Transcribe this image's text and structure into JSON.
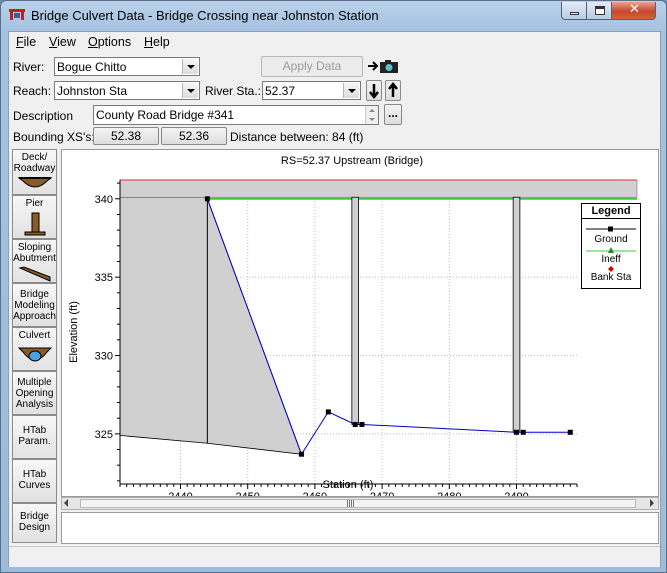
{
  "window": {
    "title": "Bridge Culvert Data - Bridge Crossing near Johnston Station",
    "minimize_icon": "minimize-icon",
    "maximize_icon": "maximize-icon",
    "close_icon": "close-icon"
  },
  "menu": [
    {
      "key": "F",
      "rest": "ile"
    },
    {
      "key": "V",
      "rest": "iew"
    },
    {
      "key": "O",
      "rest": "ptions"
    },
    {
      "key": "H",
      "rest": "elp"
    }
  ],
  "form": {
    "river_label": "River:",
    "river_value": "Bogue Chitto",
    "apply_label": "Apply Data",
    "reach_label": "Reach:",
    "reach_value": "Johnston Sta",
    "river_sta_label": "River Sta.:",
    "river_sta_value": "52.37",
    "description_label": "Description",
    "description_value": "County Road Bridge #341",
    "ellipsis": "...",
    "bounding_label": "Bounding XS's:",
    "bounding_up": "52.38",
    "bounding_down": "52.36",
    "distance_text": "Distance between: 84 (ft)"
  },
  "sidebar": [
    {
      "lines": [
        "Deck/",
        "Roadway"
      ],
      "icon": "deck-roadway-icon"
    },
    {
      "lines": [
        "Pier"
      ],
      "icon": "pier-icon"
    },
    {
      "lines": [
        "Sloping",
        "Abutment"
      ],
      "icon": "sloping-abutment-icon"
    },
    {
      "lines": [
        "Bridge",
        "Modeling",
        "Approach"
      ],
      "icon": ""
    },
    {
      "lines": [
        "Culvert"
      ],
      "icon": "culvert-icon"
    },
    {
      "lines": [
        "Multiple",
        "Opening",
        "Analysis"
      ],
      "icon": ""
    },
    {
      "lines": [
        "HTab",
        "Param."
      ],
      "icon": ""
    },
    {
      "lines": [
        "HTab",
        "Curves"
      ],
      "icon": ""
    },
    {
      "lines": [
        "Bridge",
        "Design"
      ],
      "icon": ""
    }
  ],
  "colors": {
    "ground": "#0000c8",
    "ineff": "#3cc83c",
    "bank": "#e00000",
    "deck_fill": "#d0d0d0",
    "deck_top": "#e05050"
  },
  "chart_data": {
    "type": "line",
    "title": "RS=52.37   Upstream  (Bridge)",
    "xlabel": "Station (ft)",
    "ylabel": "Elevation (ft)",
    "xlim": [
      2431,
      2499
    ],
    "ylim": [
      321.8,
      341.2
    ],
    "xticks": [
      2440,
      2450,
      2460,
      2470,
      2480,
      2490
    ],
    "yticks": [
      325,
      330,
      335,
      340
    ],
    "grid": true,
    "legend": {
      "title": "Legend",
      "placement": "top-right",
      "entries": [
        "Ground",
        "Ineff",
        "Bank Sta"
      ]
    },
    "series": [
      {
        "name": "Ground",
        "points": [
          [
            2444,
            340
          ],
          [
            2458,
            323.7
          ],
          [
            2462,
            326.4
          ],
          [
            2466,
            325.6
          ],
          [
            2467,
            325.6
          ],
          [
            2490,
            325.1
          ],
          [
            2491,
            325.1
          ],
          [
            2498,
            325.1
          ]
        ]
      }
    ],
    "ineff": {
      "x": [
        2444,
        2499
      ],
      "y": 340
    },
    "deck": {
      "high_chord": 341.2,
      "low_chord": 340.1
    },
    "deck_left_fill": {
      "x_start": 2431,
      "x_end": 2444,
      "bottom_left": 324.9,
      "bottom_right": 324.4
    },
    "piers": [
      {
        "left": 2465.5,
        "right": 2466.5,
        "bottom": 325.6
      },
      {
        "left": 2489.5,
        "right": 2490.5,
        "bottom": 325.1
      }
    ]
  }
}
